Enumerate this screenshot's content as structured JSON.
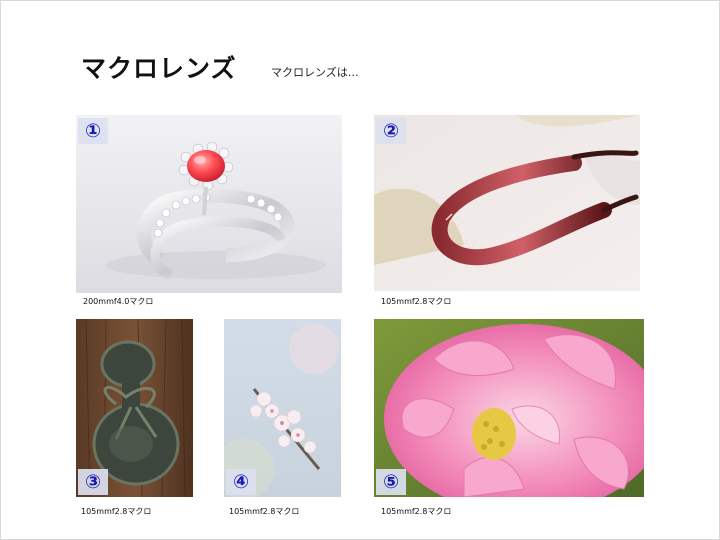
{
  "slide": {
    "title": "マクロレンズ",
    "subtitle": "マクロレンズは…"
  },
  "photos": [
    {
      "number": "①",
      "caption": "200mmf4.0マクロ",
      "subject": "ring-with-red-stone"
    },
    {
      "number": "②",
      "caption": "105mmf2.8マクロ",
      "subject": "hairpin"
    },
    {
      "number": "③",
      "caption": "105mmf2.8マクロ",
      "subject": "gourd-ornament"
    },
    {
      "number": "④",
      "caption": "105mmf2.8マクロ",
      "subject": "cherry-blossoms"
    },
    {
      "number": "⑤",
      "caption": "105mmf2.8マクロ",
      "subject": "pink-peony"
    }
  ],
  "colors": {
    "badge_text": "#1a1ab0",
    "badge_bg": "#dce1f0"
  }
}
